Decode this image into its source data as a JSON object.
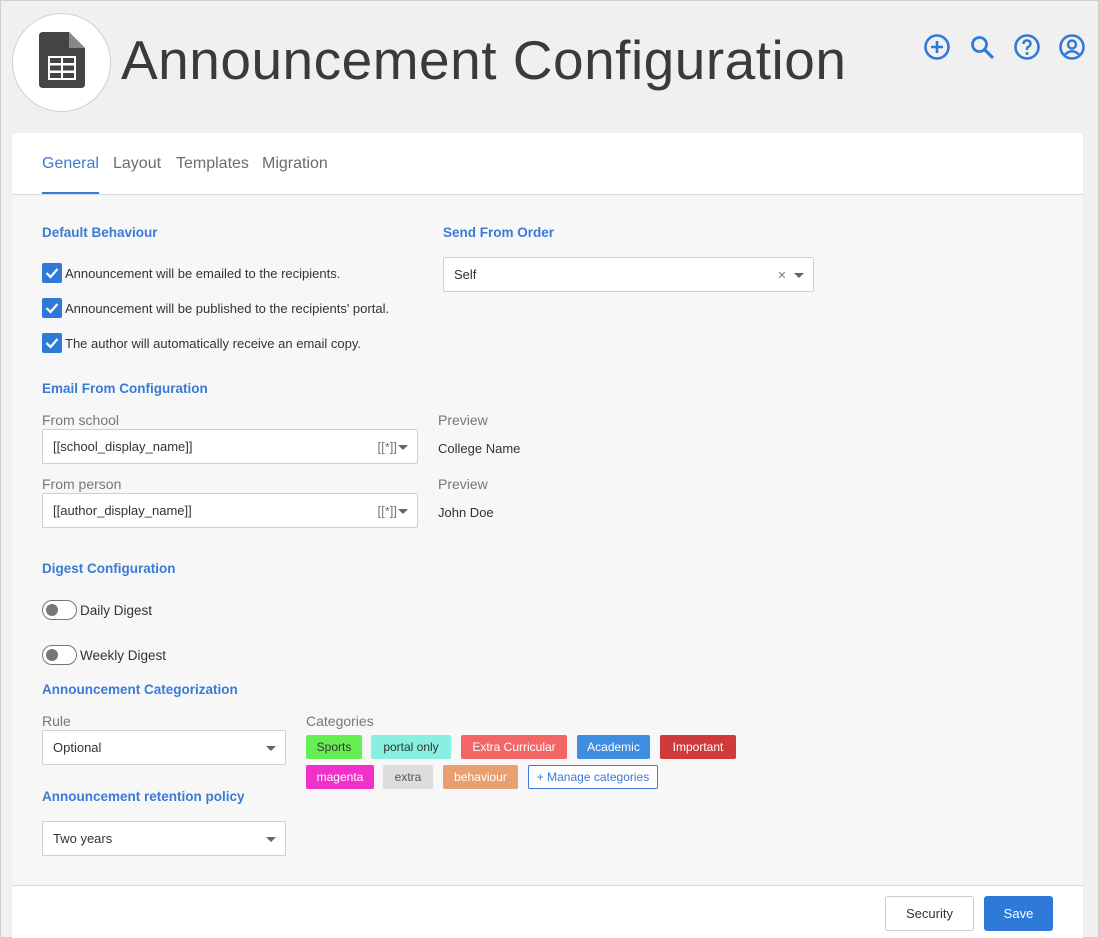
{
  "header": {
    "title": "Announcement Configuration",
    "logo_icon": "spreadsheet-document-icon",
    "actions": [
      "add-icon",
      "search-icon",
      "help-icon",
      "account-icon"
    ],
    "accent": "#3a7bd5"
  },
  "tabs": [
    {
      "label": "General",
      "active": true
    },
    {
      "label": "Layout",
      "active": false
    },
    {
      "label": "Templates",
      "active": false
    },
    {
      "label": "Migration",
      "active": false
    }
  ],
  "default_behaviour": {
    "title": "Default Behaviour",
    "options": [
      {
        "label": "Announcement will be emailed to the recipients.",
        "checked": true
      },
      {
        "label": "Announcement will be published to the recipients' portal.",
        "checked": true
      },
      {
        "label": "The author will automatically receive an email copy.",
        "checked": true
      }
    ]
  },
  "send_from_order": {
    "title": "Send From Order",
    "value": "Self",
    "clear_symbol": "×"
  },
  "email_from": {
    "title": "Email From Configuration",
    "from_school": {
      "label": "From school",
      "value": "[[school_display_name]]",
      "token": "[[*]]",
      "preview_label": "Preview",
      "preview_value": "College Name"
    },
    "from_person": {
      "label": "From person",
      "value": "[[author_display_name]]",
      "token": "[[*]]",
      "preview_label": "Preview",
      "preview_value": "John Doe"
    }
  },
  "digest": {
    "title": "Digest Configuration",
    "daily": {
      "label": "Daily Digest",
      "on": false
    },
    "weekly": {
      "label": "Weekly Digest",
      "on": false
    }
  },
  "categorization": {
    "title": "Announcement Categorization",
    "rule_label": "Rule",
    "rule_value": "Optional",
    "categories_label": "Categories",
    "categories": [
      {
        "label": "Sports",
        "bg": "#66ee55",
        "fg": "#333333"
      },
      {
        "label": "portal only",
        "bg": "#88f0e0",
        "fg": "#333333"
      },
      {
        "label": "Extra Curricular",
        "bg": "#f26666",
        "fg": "#ffffff"
      },
      {
        "label": "Academic",
        "bg": "#3f8de0",
        "fg": "#ffffff"
      },
      {
        "label": "Important",
        "bg": "#d03a3a",
        "fg": "#ffffff"
      },
      {
        "label": "magenta",
        "bg": "#f030c8",
        "fg": "#ffffff"
      },
      {
        "label": "extra",
        "bg": "#dddddd",
        "fg": "#555555"
      },
      {
        "label": "behaviour",
        "bg": "#e8a070",
        "fg": "#ffffff"
      }
    ],
    "manage_label": "+ Manage categories"
  },
  "retention": {
    "title": "Announcement retention policy",
    "value": "Two years"
  },
  "footer": {
    "security_label": "Security",
    "save_label": "Save"
  }
}
